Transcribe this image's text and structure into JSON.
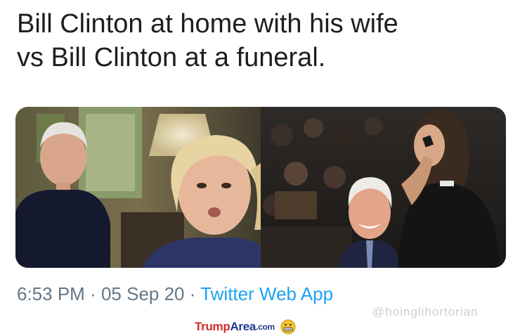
{
  "tweet": {
    "text_line1": "Bill Clinton at home with his wife",
    "text_line2": "vs Bill Clinton at a funeral.",
    "time": "6:53 PM",
    "separator": "·",
    "date": "05 Sep 20",
    "source_app": "Twitter Web App"
  },
  "media": {
    "left_panel": "photo-clinton-home-video-call",
    "right_panel": "photo-clinton-funeral-singer"
  },
  "watermark": {
    "faint_text": "@hoinglihortorian",
    "logo_part1": "Trump",
    "logo_part2": "Area",
    "logo_part3": ".com",
    "logo_icon": "grimace-face-icon"
  },
  "colors": {
    "link": "#1da1f2",
    "meta": "#657786",
    "logo_red": "#d42a2a",
    "logo_blue": "#1d3b8a"
  }
}
